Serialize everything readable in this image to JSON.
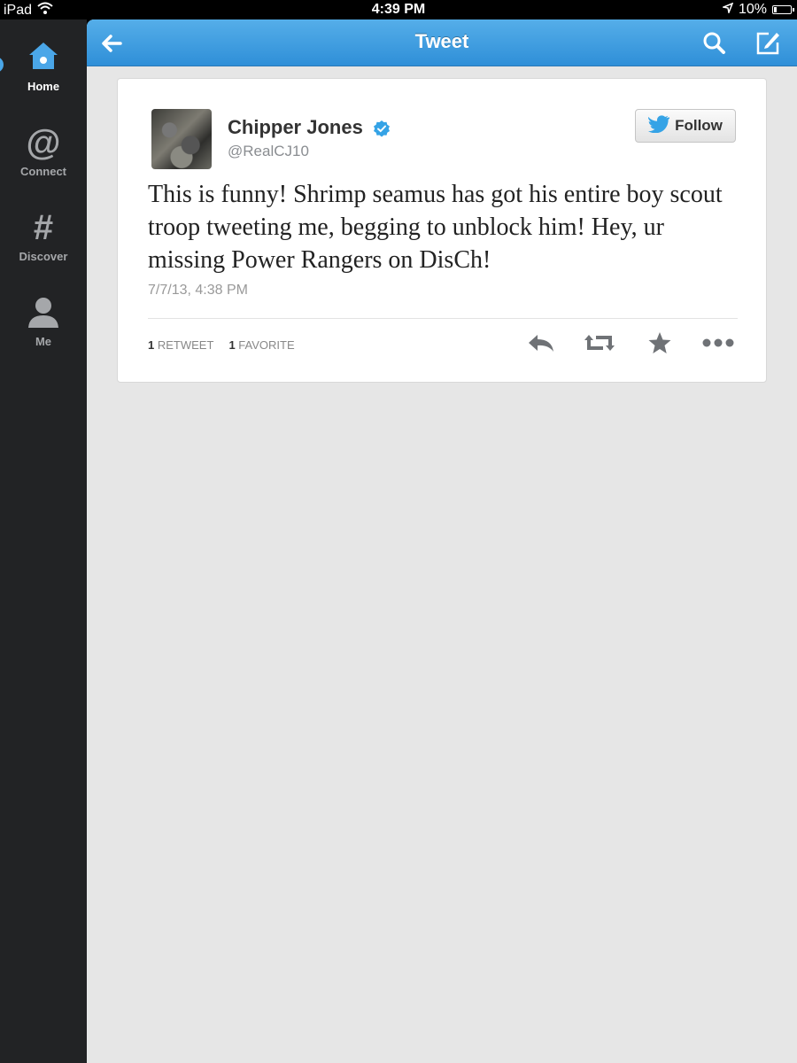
{
  "status_bar": {
    "device": "iPad",
    "time": "4:39 PM",
    "battery": "10%"
  },
  "sidebar": {
    "items": [
      {
        "label": "Home",
        "icon": "home-icon",
        "active": true
      },
      {
        "label": "Connect",
        "icon": "at-icon",
        "glyph": "@"
      },
      {
        "label": "Discover",
        "icon": "hash-icon",
        "glyph": "#"
      },
      {
        "label": "Me",
        "icon": "person-icon"
      }
    ]
  },
  "navbar": {
    "title": "Tweet",
    "back_icon": "back-arrow-icon",
    "search_icon": "search-icon",
    "compose_icon": "compose-icon"
  },
  "tweet": {
    "name": "Chipper Jones",
    "handle": "@RealCJ10",
    "verified": true,
    "follow_label": "Follow",
    "text": "This is funny! Shrimp seamus has got his entire boy scout troop tweeting me, begging to unblock him! Hey, ur missing Power Rangers on DisCh!",
    "timestamp": "7/7/13, 4:38 PM",
    "retweet_count": "1",
    "retweet_label": "RETWEET",
    "favorite_count": "1",
    "favorite_label": "FAVORITE"
  },
  "colors": {
    "nav_blue": "#2f8fd8",
    "sidebar_bg": "#222325",
    "verified_blue": "#35a3e6",
    "twitter_blue": "#35a3e6"
  }
}
